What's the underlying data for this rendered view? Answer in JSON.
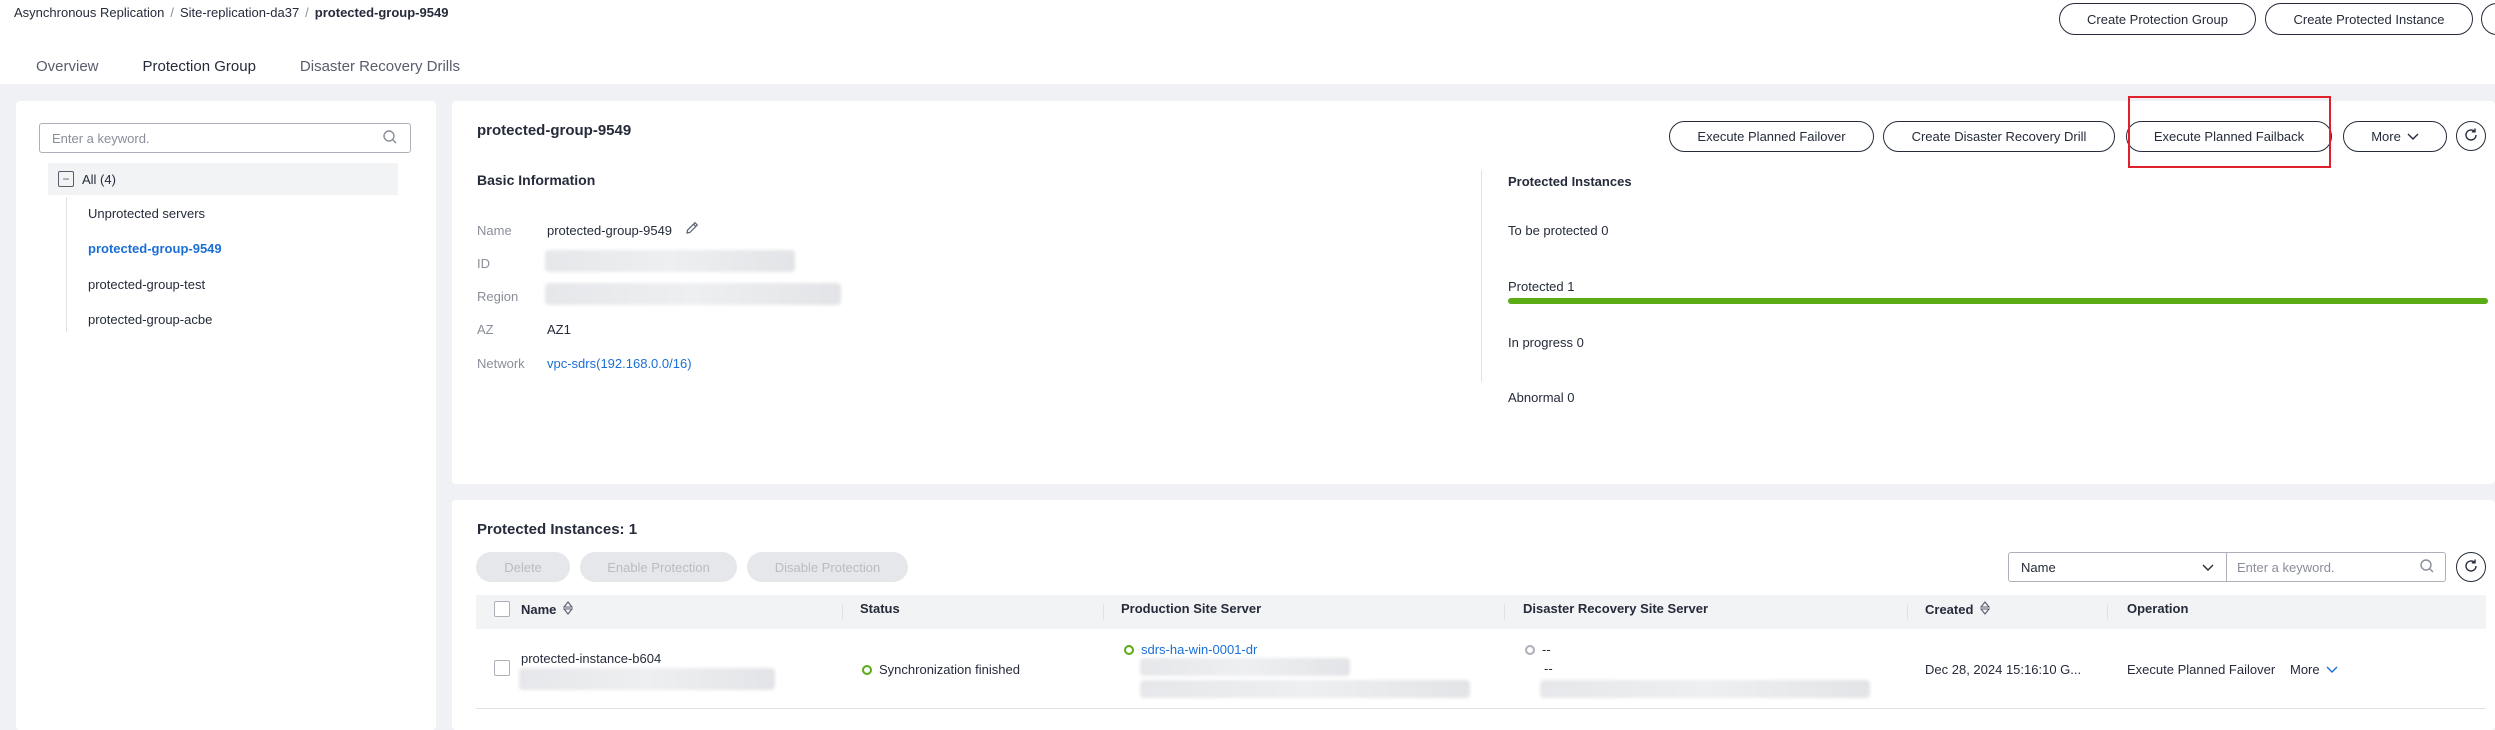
{
  "breadcrumb": {
    "items": [
      "Asynchronous Replication",
      "Site-replication-da37",
      "protected-group-9549"
    ],
    "separator": "/"
  },
  "top_actions": {
    "create_group": "Create Protection Group",
    "create_instance": "Create Protected Instance"
  },
  "tabs": [
    {
      "label": "Overview",
      "active": false
    },
    {
      "label": "Protection Group",
      "active": true
    },
    {
      "label": "Disaster Recovery Drills",
      "active": false
    }
  ],
  "sidebar": {
    "search_placeholder": "Enter a keyword.",
    "all_label": "All (4)",
    "all_toggle": "−",
    "items": [
      {
        "label": "Unprotected servers",
        "active": false
      },
      {
        "label": "protected-group-9549",
        "active": true
      },
      {
        "label": "protected-group-test",
        "active": false
      },
      {
        "label": "protected-group-acbe",
        "active": false
      }
    ]
  },
  "detail": {
    "title": "protected-group-9549",
    "actions": {
      "failover": "Execute Planned Failover",
      "drill": "Create Disaster Recovery Drill",
      "failback": "Execute Planned Failback",
      "more": "More"
    },
    "basic_info": {
      "heading": "Basic Information",
      "name_label": "Name",
      "name_value": "protected-group-9549",
      "id_label": "ID",
      "region_label": "Region",
      "az_label": "AZ",
      "az_value": "AZ1",
      "network_label": "Network",
      "network_value": "vpc-sdrs(192.168.0.0/16)"
    },
    "protected_instances": {
      "heading": "Protected Instances",
      "to_be_protected": "To be protected 0",
      "protected": "Protected 1",
      "protected_progress": 1.0,
      "in_progress": "In progress 0",
      "abnormal": "Abnormal 0"
    }
  },
  "instances": {
    "heading": "Protected Instances: 1",
    "buttons": {
      "delete": "Delete",
      "enable": "Enable Protection",
      "disable": "Disable Protection"
    },
    "filter": {
      "field": "Name",
      "placeholder": "Enter a keyword."
    },
    "columns": [
      "Name",
      "Status",
      "Production Site Server",
      "Disaster Recovery Site Server",
      "Created",
      "Operation"
    ],
    "rows": [
      {
        "name": "protected-instance-b604",
        "status": "Synchronization finished",
        "production_server": "sdrs-ha-win-0001-dr",
        "dr_server": "--",
        "dr_server_sub": "--",
        "created": "Dec 28, 2024 15:16:10 G...",
        "operation": "Execute Planned Failover",
        "more": "More"
      }
    ]
  },
  "colors": {
    "accent": "#1a6fd6",
    "success": "#5bab17",
    "highlight": "#e0212d",
    "text": "#252b3a",
    "muted": "#8a8e99"
  }
}
